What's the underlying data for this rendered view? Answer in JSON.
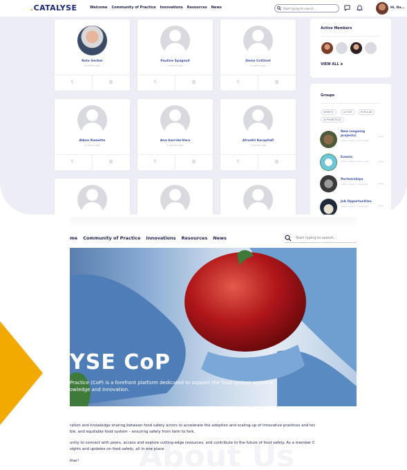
{
  "top": {
    "logo": "CATALYSE",
    "nav": [
      "Welcome",
      "Community of Practice",
      "Innovations",
      "Resources",
      "News"
    ],
    "search_placeholder": "Start typing to search...",
    "user_name": "Hi, Da...",
    "members": [
      {
        "name": "Reto Gerber",
        "time": "a month ago"
      },
      {
        "name": "Pauline Spagnoli",
        "time": "a month ago"
      },
      {
        "name": "Denis Cottinet",
        "time": "a month ago"
      },
      {
        "name": "Alban Ramette",
        "time": "a month ago"
      },
      {
        "name": "Ana Garrido-Varo",
        "time": "2 months ago"
      },
      {
        "name": "Afroditi Karapliafi",
        "time": "2 months ago"
      }
    ],
    "active_members_title": "Active Members",
    "view_all": "VIEW ALL",
    "groups_title": "Groups",
    "group_filters": [
      "NEWEST",
      "ACTIVE",
      "POPULAR",
      "ALPHABETICAL"
    ],
    "groups": [
      {
        "name": "New (ongoing projects)",
        "meta": "active 1 week, 6 hours ago"
      },
      {
        "name": "Events",
        "meta": "active 1 week, 6 hours ago"
      },
      {
        "name": "Partnerships",
        "meta": "active 1 week, 1 week ago"
      },
      {
        "name": "Job Opportunities",
        "meta": "active 1 week, 1 week ago"
      }
    ]
  },
  "bottom": {
    "nav": [
      "me",
      "Community of Practice",
      "Innovations",
      "Resources",
      "News"
    ],
    "search_placeholder": "Start typing to search...",
    "hero_title": "YSE CoP",
    "hero_line1": "Practice (CoP) is a forefront platform dedicated to support the food system actors in",
    "hero_line2": "owledge and innovation.",
    "para1_line1": "ration and knowledge sharing between food safety actors to accelerate the adoption and scaling-up of innovative practices and tec",
    "para1_line2": "ble, and equitable food system – ensuring safety from farm to fork.",
    "para2_line1": "unity to connect with peers, access and explore cutting-edge resources, and contribute to the future of food safety. As a member C",
    "para2_line2": "sights and updates on food safety, all in one place.",
    "para3": "ther!",
    "watermark": "About Us"
  },
  "colors": {
    "accent": "#f2a900",
    "navy": "#1c1f4a",
    "link": "#3b4fa8",
    "panel_bg": "#edeef5"
  }
}
